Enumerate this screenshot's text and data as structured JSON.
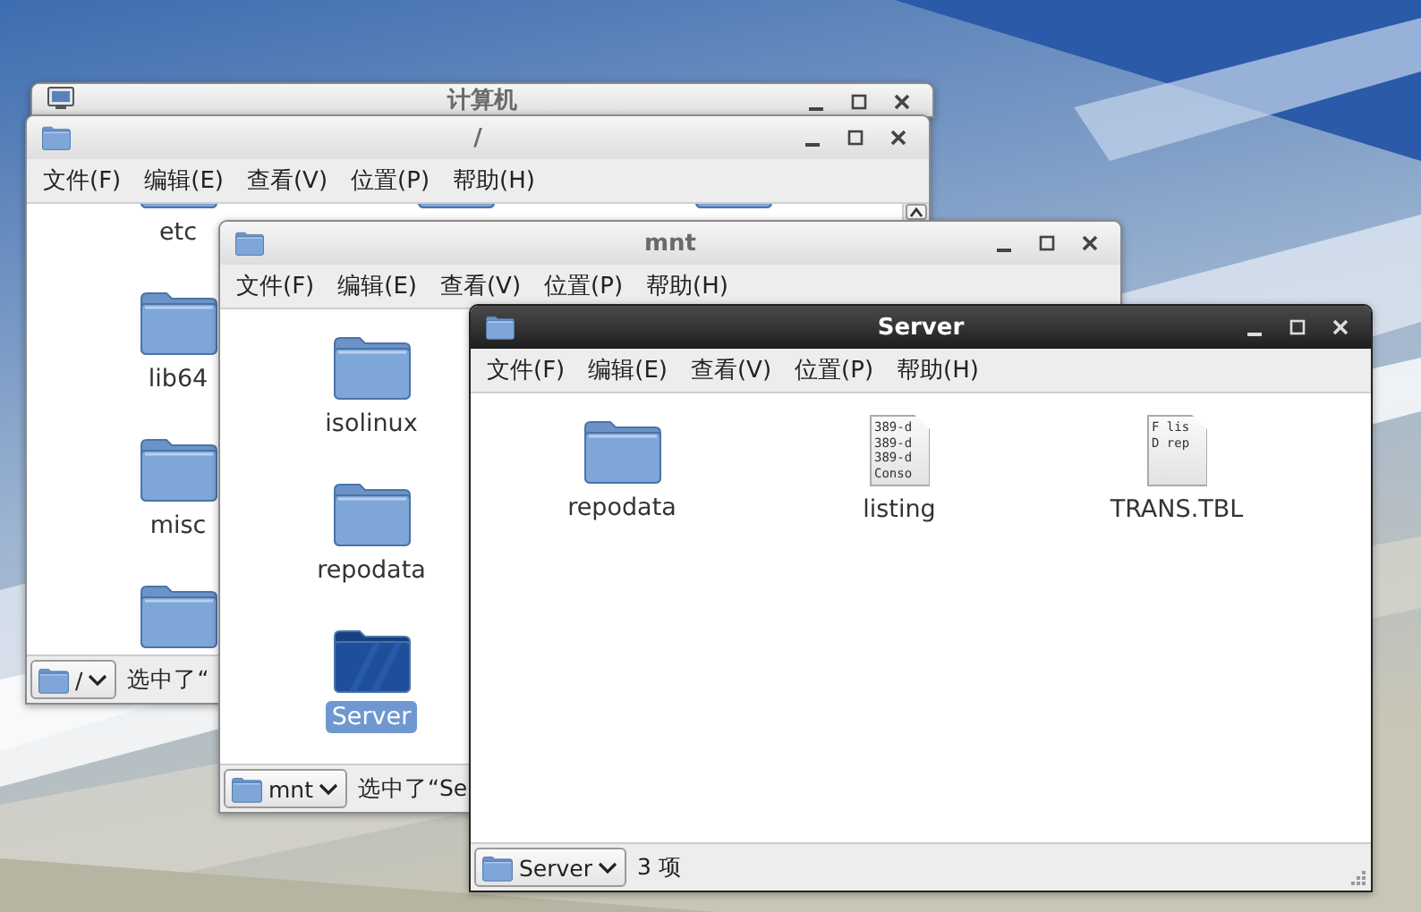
{
  "windows": [
    {
      "title": "计算机",
      "active": false
    },
    {
      "title": "/",
      "active": false,
      "menu": [
        "文件(F)",
        "编辑(E)",
        "查看(V)",
        "位置(P)",
        "帮助(H)"
      ],
      "items": [
        {
          "kind": "folder",
          "label": "etc",
          "selected": false
        },
        {
          "kind": "folder"
        },
        {
          "kind": "folder"
        },
        {
          "kind": "folder",
          "label": "lib64",
          "selected": false
        },
        {
          "kind": "spacer"
        },
        {
          "kind": "spacer"
        },
        {
          "kind": "folder",
          "label": "misc",
          "selected": false
        },
        {
          "kind": "spacer"
        },
        {
          "kind": "spacer"
        },
        {
          "kind": "folder"
        }
      ],
      "location": "/",
      "status": "选中了“"
    },
    {
      "title": "mnt",
      "active": false,
      "menu": [
        "文件(F)",
        "编辑(E)",
        "查看(V)",
        "位置(P)",
        "帮助(H)"
      ],
      "items": [
        {
          "kind": "folder",
          "label": "isolinux",
          "selected": false
        },
        {
          "kind": "spacer"
        },
        {
          "kind": "spacer"
        },
        {
          "kind": "folder",
          "label": "repodata",
          "selected": false
        },
        {
          "kind": "spacer"
        },
        {
          "kind": "spacer"
        },
        {
          "kind": "folder",
          "label": "Server",
          "selected": true
        }
      ],
      "location": "mnt",
      "status": "选中了“Se"
    },
    {
      "title": "Server",
      "active": true,
      "menu": [
        "文件(F)",
        "编辑(E)",
        "查看(V)",
        "位置(P)",
        "帮助(H)"
      ],
      "items": [
        {
          "kind": "folder",
          "label": "repodata",
          "selected": false
        },
        {
          "kind": "document",
          "label": "listing",
          "preview": [
            "389-d",
            "389-d",
            "389-d",
            "Conso"
          ],
          "selected": false
        },
        {
          "kind": "document",
          "label": "TRANS.TBL",
          "preview": [
            "F lis",
            "D rep"
          ],
          "selected": false
        }
      ],
      "location": "Server",
      "status": "3 项"
    }
  ]
}
